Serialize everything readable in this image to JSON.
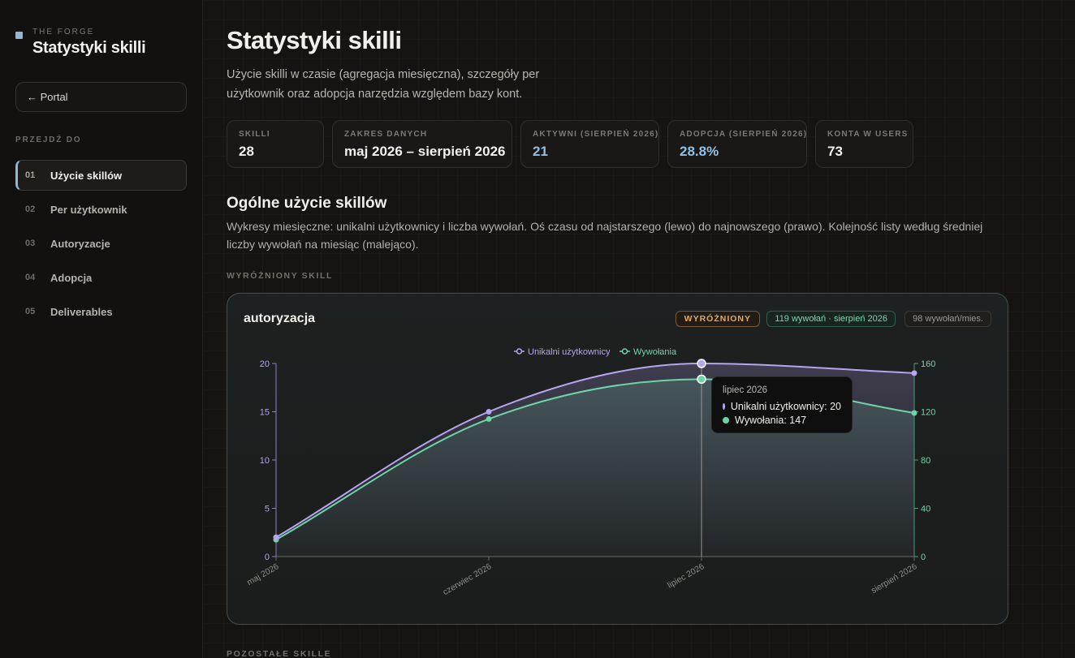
{
  "sidebar": {
    "brand_kicker": "THE FORGE",
    "brand_title": "Statystyki skilli",
    "portal_label": "← Portal",
    "nav_heading": "PRZEJDŹ DO",
    "items": [
      {
        "num": "01",
        "label": "Użycie skillów",
        "active": true
      },
      {
        "num": "02",
        "label": "Per użytkownik",
        "active": false
      },
      {
        "num": "03",
        "label": "Autoryzacje",
        "active": false
      },
      {
        "num": "04",
        "label": "Adopcja",
        "active": false
      },
      {
        "num": "05",
        "label": "Deliverables",
        "active": false
      }
    ]
  },
  "header": {
    "title": "Statystyki skilli",
    "description": "Użycie skilli w czasie (agregacja miesięczna), szczegóły per użytkownik oraz adopcja narzędzia względem bazy kont."
  },
  "stats": [
    {
      "label": "SKILLI",
      "value": "28",
      "accent": false
    },
    {
      "label": "ZAKRES DANYCH",
      "value": "maj 2026 – sierpień 2026",
      "accent": false
    },
    {
      "label": "AKTYWNI (SIERPIEŃ 2026)",
      "value": "21",
      "accent": true
    },
    {
      "label": "ADOPCJA (SIERPIEŃ 2026)",
      "value": "28.8%",
      "accent": true
    },
    {
      "label": "KONTA W USERS",
      "value": "73",
      "accent": false
    }
  ],
  "usage": {
    "title": "Ogólne użycie skillów",
    "description": "Wykresy miesięczne: unikalni użytkownicy i liczba wywołań. Oś czasu od najstarszego (lewo) do najnowszego (prawo). Kolejność listy według średniej liczby wywołań na miesiąc (malejąco).",
    "featured_kicker": "WYRÓŻNIONY SKILL",
    "others_kicker": "POZOSTAŁE SKILLE"
  },
  "featured": {
    "name": "autoryzacja",
    "badge_featured": "WYRÓŻNIONY",
    "badge_calls": "119 wywołań · sierpień 2026",
    "badge_avg": "98 wywołań/mies."
  },
  "tooltip": {
    "title": "lipiec 2026",
    "users_line": "Unikalni użytkownicy: 20",
    "calls_line": "Wywołania: 147"
  },
  "colors": {
    "users": "#b7a4f0",
    "calls": "#6fd3a8",
    "accent": "#8fc0e8"
  },
  "chart_data": {
    "type": "line",
    "categories": [
      "maj 2026",
      "czerwiec 2026",
      "lipiec 2026",
      "sierpień 2026"
    ],
    "series": [
      {
        "name": "Unikalni użytkownicy",
        "axis": "left",
        "values": [
          2,
          15,
          20,
          19
        ]
      },
      {
        "name": "Wywołania",
        "axis": "right",
        "values": [
          14,
          114,
          147,
          119
        ]
      }
    ],
    "y_left": {
      "ticks": [
        0,
        5,
        10,
        15,
        20
      ],
      "range": [
        0,
        20
      ]
    },
    "y_right": {
      "ticks": [
        0,
        40,
        80,
        120,
        160
      ],
      "range": [
        0,
        160
      ]
    },
    "legend_position": "top-center",
    "highlighted_category": "lipiec 2026"
  }
}
